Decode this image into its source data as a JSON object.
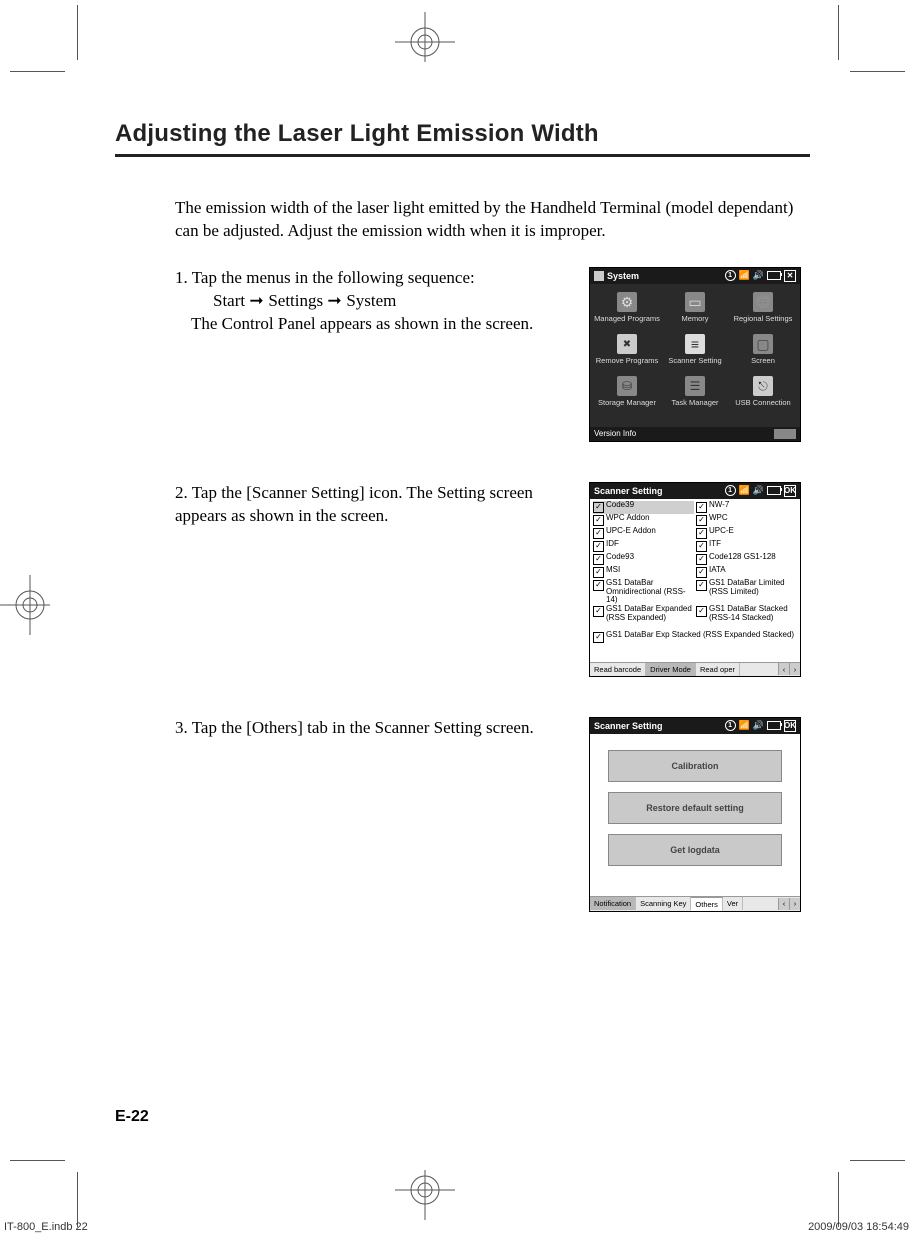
{
  "title": "Adjusting the Laser Light Emission Width",
  "intro": "The emission width of the laser light emitted by the Handheld Terminal (model dependant) can be adjusted. Adjust the emission width when it is improper.",
  "steps": {
    "s1": {
      "num": "1.",
      "line1": "Tap the menus in the following sequence:",
      "path_start": "Start",
      "path_settings": "Settings",
      "path_system": "System",
      "line3": "The Control Panel appears as shown in the screen."
    },
    "s2": {
      "num": "2.",
      "text": "Tap the [Scanner Setting] icon. The Setting screen appears as shown in the screen."
    },
    "s3": {
      "num": "3.",
      "text": "Tap the [Others] tab in the Scanner Setting screen."
    }
  },
  "shot1": {
    "title": "System",
    "tray_num": "1",
    "items": {
      "managed": "Managed Programs",
      "memory": "Memory",
      "regional": "Regional Settings",
      "remove": "Remove Programs",
      "scanner": "Scanner Setting",
      "screen": "Screen",
      "storage": "Storage Manager",
      "task": "Task Manager",
      "usb": "USB Connection"
    },
    "version": "Version Info"
  },
  "shot2": {
    "title": "Scanner Setting",
    "ok": "OK",
    "tray_num": "1",
    "left": {
      "code39": "Code39",
      "wpc_addon": "WPC Addon",
      "upce_addon": "UPC-E Addon",
      "idf": "IDF",
      "code93": "Code93",
      "msi": "MSI",
      "gs1_omni": "GS1 DataBar Omnidirectional (RSS-14)",
      "gs1_exp": "GS1 DataBar Expanded (RSS Expanded)",
      "gs1_exp_stk": "GS1 DataBar Exp Stacked (RSS Expanded Stacked)"
    },
    "right": {
      "nw7": "NW-7",
      "wpc": "WPC",
      "upce": "UPC-E",
      "itf": "ITF",
      "code128": "Code128 GS1-128",
      "iata": "IATA",
      "gs1_lim": "GS1 DataBar Limited (RSS Limited)",
      "gs1_stk": "GS1 DataBar Stacked (RSS-14 Stacked)"
    },
    "tabs": {
      "read": "Read barcode",
      "driver": "Driver Mode",
      "readop": "Read oper"
    }
  },
  "shot3": {
    "title": "Scanner Setting",
    "ok": "OK",
    "tray_num": "1",
    "buttons": {
      "calibration": "Calibration",
      "restore": "Restore default setting",
      "getlog": "Get logdata"
    },
    "tabs": {
      "notification": "Notification",
      "scanning": "Scanning Key",
      "others": "Others",
      "ver": "Ver"
    }
  },
  "page_number": "E-22",
  "footer": {
    "file": "IT-800_E.indb   22",
    "date": "2009/09/03   18:54:49"
  }
}
